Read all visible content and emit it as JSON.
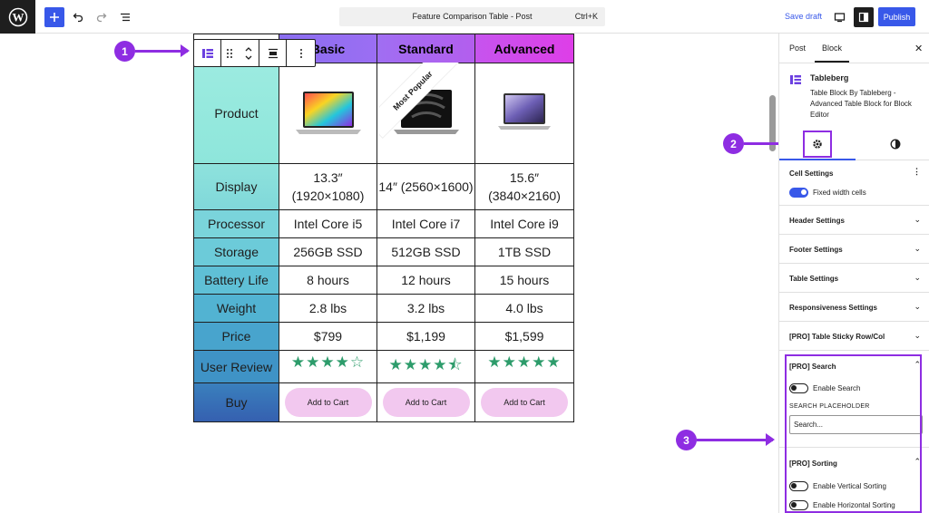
{
  "topbar": {
    "command_title": "Feature Comparison Table - Post",
    "command_shortcut": "Ctrl+K",
    "save_draft": "Save draft",
    "publish": "Publish"
  },
  "table": {
    "headers": [
      "",
      "Basic",
      "Standard",
      "Advanced"
    ],
    "product_label": "Product",
    "ribbon": "Most Popular",
    "rows": [
      {
        "label": "Display",
        "values": [
          "13.3″ (1920×1080)",
          "14″ (2560×1600)",
          "15.6″ (3840×2160)"
        ]
      },
      {
        "label": "Processor",
        "values": [
          "Intel Core i5",
          "Intel Core i7",
          "Intel Core i9"
        ]
      },
      {
        "label": "Storage",
        "values": [
          "256GB SSD",
          "512GB SSD",
          "1TB SSD"
        ]
      },
      {
        "label": "Battery Life",
        "values": [
          "8 hours",
          "12 hours",
          "15 hours"
        ]
      },
      {
        "label": "Weight",
        "values": [
          "2.8 lbs",
          "3.2 lbs",
          "4.0 lbs"
        ]
      },
      {
        "label": "Price",
        "values": [
          "$799",
          "$1,199",
          "$1,599"
        ]
      }
    ],
    "review_label": "User Review",
    "reviews": [
      "★★★★☆",
      "★★★★⯪",
      "★★★★★"
    ],
    "review_ratings": [
      4,
      4.5,
      5
    ],
    "buy_label": "Buy",
    "cart_label": "Add to Cart"
  },
  "callouts": [
    "1",
    "2",
    "3"
  ],
  "sidebar": {
    "tabs": [
      "Post",
      "Block"
    ],
    "active_tab": "Block",
    "block_title": "Tableberg",
    "block_desc": "Table Block By Tableberg - Advanced Table Block for Block Editor",
    "panels": {
      "cell_settings": "Cell Settings",
      "fixed_width": "Fixed width cells",
      "header": "Header Settings",
      "footer": "Footer Settings",
      "table": "Table Settings",
      "responsive": "Responsiveness Settings",
      "sticky": "[PRO] Table Sticky Row/Col",
      "search": "[PRO] Search",
      "enable_search": "Enable Search",
      "search_placeholder_label": "SEARCH PLACEHOLDER",
      "search_placeholder_value": "Search...",
      "sorting": "[PRO] Sorting",
      "vertical_sorting": "Enable Vertical Sorting",
      "horizontal_sorting": "Enable Horizontal Sorting"
    }
  },
  "colors": {
    "accent": "#3858e9",
    "callout": "#8e2de2",
    "stars": "#2d9c6b",
    "cart_bg": "#f2c8ef"
  }
}
